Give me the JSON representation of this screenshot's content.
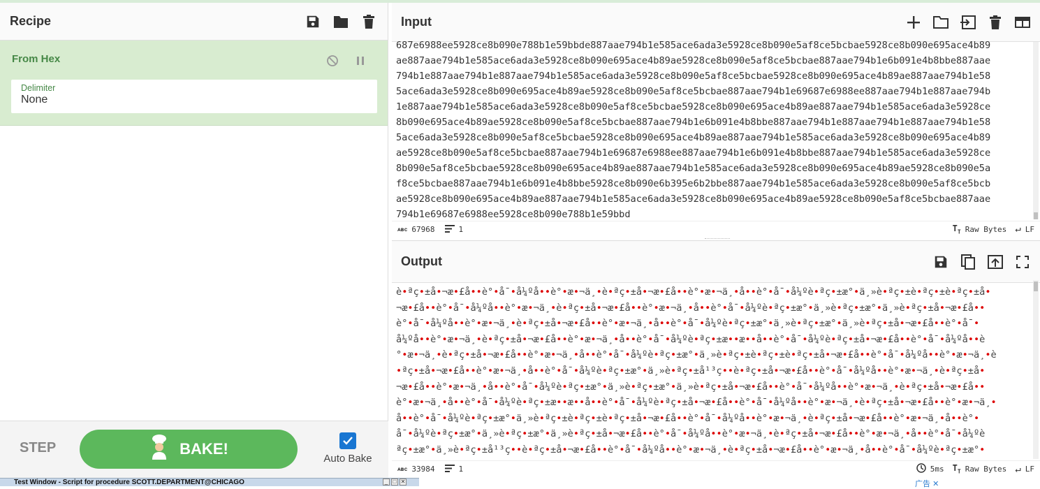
{
  "recipe": {
    "title": "Recipe",
    "operation": {
      "name": "From Hex",
      "delimiter_label": "Delimiter",
      "delimiter_value": "None"
    },
    "step_label": "STEP",
    "bake_label": "BAKE!",
    "autobake_label": "Auto Bake",
    "autobake_checked": true
  },
  "input": {
    "title": "Input",
    "lines": [
      "687e6988ee5928ce8b090e788b1e59bbde887aae794b1e585ace6ada3e5928ce8b090e5af8ce5bcbae5928ce8b090e695ace4b89",
      "ae887aae794b1e585ace6ada3e5928ce8b090e695ace4b89ae5928ce8b090e5af8ce5bcbae887aae794b1e6b091e4b8bbe887aae",
      "794b1e887aae794b1e887aae794b1e585ace6ada3e5928ce8b090e5af8ce5bcbae5928ce8b090e695ace4b89ae887aae794b1e58",
      "5ace6ada3e5928ce8b090e695ace4b89ae5928ce8b090e5af8ce5bcbae887aae794b1e69687e6988ee887aae794b1e887aae794b",
      "1e887aae794b1e585ace6ada3e5928ce8b090e5af8ce5bcbae5928ce8b090e695ace4b89ae887aae794b1e585ace6ada3e5928ce",
      "8b090e695ace4b89ae5928ce8b090e5af8ce5bcbae887aae794b1e6b091e4b8bbe887aae794b1e887aae794b1e887aae794b1e58",
      "5ace6ada3e5928ce8b090e5af8ce5bcbae5928ce8b090e695ace4b89ae887aae794b1e585ace6ada3e5928ce8b090e695ace4b89",
      "ae5928ce8b090e5af8ce5bcbae887aae794b1e69687e6988ee887aae794b1e6b091e4b8bbe887aae794b1e585ace6ada3e5928ce",
      "8b090e5af8ce5bcbae5928ce8b090e695ace4b89ae887aae794b1e585ace6ada3e5928ce8b090e695ace4b89ae5928ce8b090e5a",
      "f8ce5bcbae887aae794b1e6b091e4b8bbe5928ce8b090e6b395e6b2bbe887aae794b1e585ace6ada3e5928ce8b090e5af8ce5bcb",
      "ae5928ce8b090e695ace4b89ae887aae794b1e585ace6ada3e5928ce8b090e695ace4b89ae5928ce8b090e5af8ce5bcbae887aae",
      "794b1e69687e6988ee5928ce8b090e788b1e59bbd"
    ],
    "char_count": "67968",
    "line_count": "1",
    "encoding": "Raw Bytes",
    "eol": "LF"
  },
  "output": {
    "title": "Output",
    "lines": [
      "è•ªç•±å•¬æ•£å••è°•å¯•å¼ºå••è°•æ•¬ä¸•è•ªç•±å•¬æ•£å••è°•æ•¬ä¸•å••è°•å¯•å¼ºè•ªç•±æ°•ä¸»è•ªç•±è•ªç•±è•ªç•±å•",
      "¬æ•£å••è°•å¯•å¼ºå••è°•æ•¬ä¸•è•ªç•±å•¬æ•£å••è°•æ•¬ä¸•å••è°•å¯•å¼ºè•ªç•±æ°•ä¸»è•ªç•±æ°•ä¸»è•ªç•±å•¬æ•£å••",
      "è°•å¯•å¼ºå••è°•æ•¬ä¸•è•ªç•±å•¬æ•£å••è°•æ•¬ä¸•å••è°•å¯•å¼ºè•ªç•±æ°•ä¸»è•ªç•±æ°•ä¸»è•ªç•±å•¬æ•£å••è°•å¯•",
      "å¼ºå••è°•æ•¬ä¸•è•ªç•±å•¬æ•£å••è°•æ•¬ä¸•å••è°•å¯•å¼ºè•ªç•±æ••æ••å••è°•å¯•å¼ºè•ªç•±å•¬æ•£å••è°•å¯•å¼ºå••è",
      "°•æ•¬ä¸•è•ªç•±å•¬æ•£å••è°•æ•¬ä¸•å••è°•å¯•å¼ºè•ªç•±æ°•ä¸»è•ªç•±è•ªç•±è•ªç•±å•¬æ•£å••è°•å¯•å¼ºå••è°•æ•¬ä¸•è",
      "•ªç•±å•¬æ•£å••è°•æ•¬ä¸•å••è°•å¯•å¼ºè•ªç•±æ°•ä¸»è•ªç•±å¹³ç••è•ªç•±å•¬æ•£å••è°•å¯•å¼ºå••è°•æ•¬ä¸•è•ªç•±å•",
      "¬æ•£å••è°•æ•¬ä¸•å••è°•å¯•å¼ºè•ªç•±æ°•ä¸»è•ªç•±æ°•ä¸»è•ªç•±å•¬æ•£å••è°•å¯•å¼ºå••è°•æ•¬ä¸•è•ªç•±å•¬æ•£å••",
      "è°•æ•¬ä¸•å••è°•å¯•å¼ºè•ªç•±æ••æ••å••è°•å¯•å¼ºè•ªç•±å•¬æ•£å••è°•å¯•å¼ºå••è°•æ•¬ä¸•è•ªç•±å•¬æ•£å••è°•æ•¬ä¸•",
      "å••è°•å¯•å¼ºè•ªç•±æ°•ä¸»è•ªç•±è•ªç•±è•ªç•±å•¬æ•£å••è°•å¯•å¼ºå••è°•æ•¬ä¸•è•ªç•±å•¬æ•£å••è°•æ•¬ä¸•å••è°•",
      "å¯•å¼ºè•ªç•±æ°•ä¸»è•ªç•±æ°•ä¸»è•ªç•±å•¬æ•£å••è°•å¯•å¼ºå••è°•æ•¬ä¸•è•ªç•±å•¬æ•£å••è°•æ•¬ä¸•å••è°•å¯•å¼ºè",
      "ªç•±æ°•ä¸»è•ªç•±å¹³ç••è•ªç•±å•¬æ•£å••è°•å¯•å¼ºå••è°•æ•¬ä¸•è•ªç•±å•¬æ•£å••è°•æ•¬ä¸•å••è°•å¯•å¼ºè•ªç•±æ°•"
    ],
    "char_count": "33984",
    "line_count": "1",
    "time": "5ms",
    "encoding": "Raw Bytes",
    "eol": "LF"
  },
  "taskbar": {
    "window_title": "Test Window - Script for procedure SCOTT.DEPARTMENT@CHICAGO",
    "ad_label": "广告"
  },
  "colors": {
    "operation_bg": "#d8ecd0",
    "operation_text": "#468847",
    "bake_button": "#5cb85c",
    "checkbox": "#1976d2",
    "unprintable_dot": "#dd0000"
  }
}
